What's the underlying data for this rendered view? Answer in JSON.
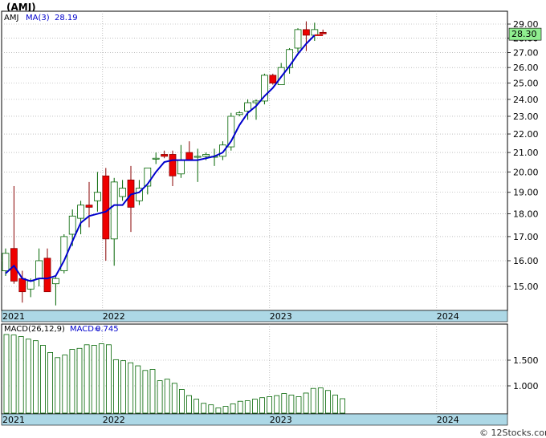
{
  "title": "(AMJ)",
  "watermark": "© 12Stocks.com",
  "colors": {
    "up_candle": "#ffffff",
    "up_border": "#006400",
    "down_candle": "#ee0000",
    "down_border": "#880000",
    "ma_line": "#0000cc",
    "ma_line_recent": "#cc0000",
    "macd_bar_border": "#006400",
    "axis_band": "#add8e6",
    "grid": "#999999",
    "price_label_bg": "#90ee90"
  },
  "chart_data": [
    {
      "type": "candlestick",
      "panel": "price",
      "legend": {
        "symbol": "AMJ",
        "ma_label": "MA(3)",
        "ma_value": "28.19"
      },
      "last_price_label": "28.30",
      "y_ticks": [
        "15.00",
        "16.00",
        "17.00",
        "18.00",
        "19.00",
        "20.00",
        "21.00",
        "22.00",
        "23.00",
        "24.00",
        "25.00",
        "26.00",
        "27.00",
        "28.00",
        "29.00"
      ],
      "log_scale": true,
      "x_tick_labels": [
        {
          "label": "2021",
          "index": 0
        },
        {
          "label": "2022",
          "index": 12
        },
        {
          "label": "2023",
          "index": 32
        },
        {
          "label": "2024",
          "index": 52
        }
      ],
      "candles": [
        {
          "o": 15.6,
          "h": 16.5,
          "l": 15.4,
          "c": 16.3
        },
        {
          "o": 16.5,
          "h": 19.3,
          "l": 15.1,
          "c": 15.2
        },
        {
          "o": 15.3,
          "h": 15.6,
          "l": 14.4,
          "c": 14.8
        },
        {
          "o": 14.9,
          "h": 15.3,
          "l": 14.6,
          "c": 15.2
        },
        {
          "o": 15.3,
          "h": 16.5,
          "l": 15.0,
          "c": 16.0
        },
        {
          "o": 16.1,
          "h": 16.5,
          "l": 14.8,
          "c": 14.8
        },
        {
          "o": 15.1,
          "h": 15.4,
          "l": 14.3,
          "c": 15.3
        },
        {
          "o": 15.6,
          "h": 17.1,
          "l": 15.5,
          "c": 17.0
        },
        {
          "o": 17.1,
          "h": 18.2,
          "l": 16.6,
          "c": 17.9
        },
        {
          "o": 17.8,
          "h": 18.6,
          "l": 17.1,
          "c": 18.4
        },
        {
          "o": 18.4,
          "h": 19.5,
          "l": 17.4,
          "c": 18.3
        },
        {
          "o": 18.6,
          "h": 20.0,
          "l": 18.1,
          "c": 19.0
        },
        {
          "o": 19.8,
          "h": 20.2,
          "l": 16.0,
          "c": 16.9
        },
        {
          "o": 16.9,
          "h": 19.7,
          "l": 15.8,
          "c": 19.5
        },
        {
          "o": 18.8,
          "h": 19.6,
          "l": 18.6,
          "c": 19.2
        },
        {
          "o": 19.6,
          "h": 20.3,
          "l": 17.2,
          "c": 18.3
        },
        {
          "o": 18.6,
          "h": 19.6,
          "l": 18.4,
          "c": 19.2
        },
        {
          "o": 19.3,
          "h": 20.2,
          "l": 18.9,
          "c": 20.2
        },
        {
          "o": 20.7,
          "h": 21.0,
          "l": 20.4,
          "c": 20.7
        },
        {
          "o": 20.9,
          "h": 21.1,
          "l": 20.7,
          "c": 20.8
        },
        {
          "o": 20.9,
          "h": 21.1,
          "l": 19.3,
          "c": 19.8
        },
        {
          "o": 19.9,
          "h": 21.4,
          "l": 19.7,
          "c": 20.6
        },
        {
          "o": 21.0,
          "h": 21.6,
          "l": 20.8,
          "c": 20.6
        },
        {
          "o": 20.8,
          "h": 21.2,
          "l": 19.5,
          "c": 20.8
        },
        {
          "o": 20.8,
          "h": 21.0,
          "l": 20.6,
          "c": 20.9
        },
        {
          "o": 20.8,
          "h": 21.2,
          "l": 20.3,
          "c": 20.8
        },
        {
          "o": 20.8,
          "h": 21.6,
          "l": 20.6,
          "c": 21.4
        },
        {
          "o": 21.3,
          "h": 23.2,
          "l": 21.1,
          "c": 23.0
        },
        {
          "o": 23.1,
          "h": 23.3,
          "l": 23.0,
          "c": 23.2
        },
        {
          "o": 23.3,
          "h": 24.0,
          "l": 22.8,
          "c": 23.8
        },
        {
          "o": 23.8,
          "h": 24.0,
          "l": 22.8,
          "c": 23.9
        },
        {
          "o": 23.9,
          "h": 25.6,
          "l": 23.7,
          "c": 25.5
        },
        {
          "o": 25.5,
          "h": 25.6,
          "l": 24.9,
          "c": 25.0
        },
        {
          "o": 24.9,
          "h": 26.3,
          "l": 24.9,
          "c": 26.0
        },
        {
          "o": 26.0,
          "h": 27.3,
          "l": 25.6,
          "c": 27.2
        },
        {
          "o": 27.3,
          "h": 28.7,
          "l": 27.0,
          "c": 28.6
        },
        {
          "o": 28.6,
          "h": 29.2,
          "l": 27.1,
          "c": 28.2
        },
        {
          "o": 28.2,
          "h": 29.1,
          "l": 27.8,
          "c": 28.6
        },
        {
          "o": 28.4,
          "h": 28.6,
          "l": 28.3,
          "c": 28.3
        }
      ],
      "ma": [
        15.5,
        15.8,
        15.3,
        15.2,
        15.3,
        15.3,
        15.4,
        16.0,
        16.8,
        17.6,
        17.9,
        18.0,
        18.1,
        18.4,
        18.4,
        18.9,
        19.0,
        19.4,
        20.0,
        20.5,
        20.6,
        20.6,
        20.6,
        20.6,
        20.7,
        20.8,
        21.0,
        21.6,
        22.5,
        23.2,
        23.6,
        24.2,
        24.7,
        25.4,
        26.1,
        26.9,
        27.6,
        28.2,
        28.2
      ]
    },
    {
      "type": "bar",
      "panel": "macd",
      "legend": {
        "name": "MACD(26,12,9)",
        "label": "MACD=",
        "value": "0.745"
      },
      "y_ticks": [
        "1.000",
        "1.500"
      ],
      "x_tick_labels": [
        {
          "label": "2021",
          "index": 0
        },
        {
          "label": "2022",
          "index": 12
        },
        {
          "label": "2023",
          "index": 32
        },
        {
          "label": "2024",
          "index": 52
        }
      ],
      "values": [
        2.0,
        1.99,
        1.96,
        1.91,
        1.88,
        1.79,
        1.65,
        1.55,
        1.6,
        1.71,
        1.73,
        1.8,
        1.79,
        1.82,
        1.8,
        1.51,
        1.49,
        1.45,
        1.39,
        1.3,
        1.32,
        1.1,
        1.13,
        1.05,
        0.93,
        0.81,
        0.74,
        0.66,
        0.63,
        0.57,
        0.6,
        0.65,
        0.7,
        0.71,
        0.74,
        0.77,
        0.79,
        0.81,
        0.85,
        0.82,
        0.79,
        0.86,
        0.95,
        0.96,
        0.91,
        0.82,
        0.75
      ]
    }
  ]
}
